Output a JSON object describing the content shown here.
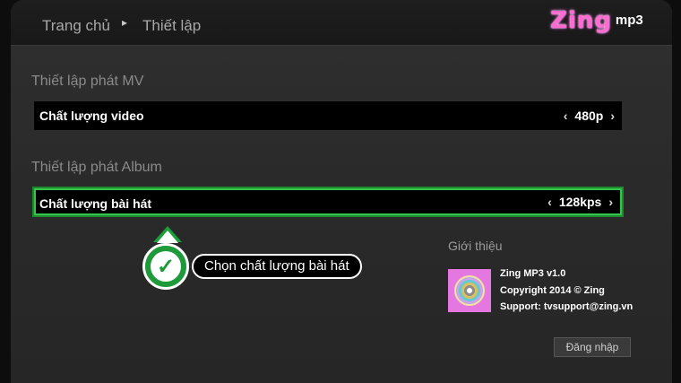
{
  "breadcrumb": {
    "home": "Trang chủ",
    "separator": "▸",
    "current": "Thiết lập"
  },
  "logo": {
    "brand": "Zing",
    "suffix": "mp3"
  },
  "sections": {
    "mv": {
      "title": "Thiết lập phát MV",
      "setting_label": "Chất lượng video",
      "value": "480p"
    },
    "album": {
      "title": "Thiết lập phát Album",
      "setting_label": "Chất lượng bài hát",
      "value": "128kps"
    }
  },
  "arrows": {
    "left": "‹",
    "right": "›"
  },
  "hint": {
    "check": "✓",
    "text": "Chọn chất lượng bài hát"
  },
  "about": {
    "title": "Giới thiệu",
    "app_name": "Zing MP3 v1.0",
    "copyright": "Copyright 2014 © Zing",
    "support": "Support: tvsupport@zing.vn"
  },
  "login_button": "Đăng nhập",
  "colors": {
    "focus": "#35c44e",
    "hint_green": "#1e9a3a",
    "logo_pink": "#ff6bcf",
    "app_icon_bg": "#e477e0"
  },
  "icons": [
    "chevron-left-icon",
    "chevron-right-icon",
    "checkmark-icon",
    "music-disc-icon"
  ]
}
